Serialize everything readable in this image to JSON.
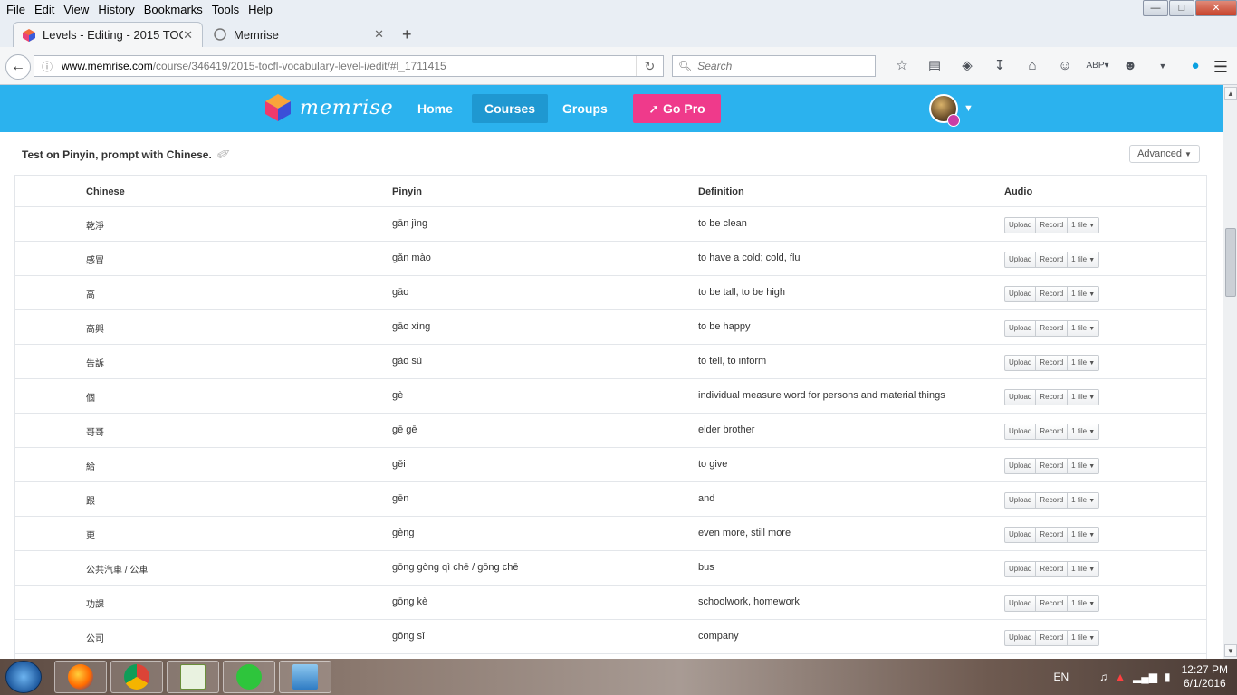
{
  "menu": [
    "File",
    "Edit",
    "View",
    "History",
    "Bookmarks",
    "Tools",
    "Help"
  ],
  "tabs": [
    {
      "title": "Levels - Editing - 2015 TOC...",
      "close": "✕"
    },
    {
      "title": "Memrise",
      "close": "✕"
    }
  ],
  "newtab": "+",
  "url": {
    "host": "www.memrise.com",
    "path": "/course/346419/2015-tocfl-vocabulary-level-i/edit/#l_1711415"
  },
  "search": {
    "placeholder": "Search"
  },
  "memrise": {
    "logo_text": "memrise",
    "nav": [
      "Home",
      "Courses",
      "Groups"
    ],
    "gopro": "Go Pro",
    "colors": {
      "header": "#2bb2ee",
      "active_nav": "#1f98d1",
      "gopro": "#ef3a8b"
    }
  },
  "level": {
    "test_label": "Test on Pinyin, prompt with Chinese.",
    "advanced": "Advanced"
  },
  "table": {
    "headers": [
      "Chinese",
      "Pinyin",
      "Definition",
      "Audio"
    ],
    "audio_buttons": {
      "upload": "Upload",
      "record": "Record",
      "files": "1 file"
    },
    "rows": [
      {
        "chinese": "乾淨",
        "pinyin": "gān jìng",
        "definition": "to be clean"
      },
      {
        "chinese": "感冒",
        "pinyin": "gǎn mào",
        "definition": "to have a cold; cold, flu"
      },
      {
        "chinese": "高",
        "pinyin": "gāo",
        "definition": "to be tall, to be high"
      },
      {
        "chinese": "高興",
        "pinyin": "gāo xìng",
        "definition": "to be happy"
      },
      {
        "chinese": "告訴",
        "pinyin": "gào sù",
        "definition": "to tell, to inform"
      },
      {
        "chinese": "個",
        "pinyin": "gè",
        "definition": "individual measure word for persons and material things"
      },
      {
        "chinese": "哥哥",
        "pinyin": "gē gē",
        "definition": "elder brother"
      },
      {
        "chinese": "給",
        "pinyin": "gěi",
        "definition": "to give"
      },
      {
        "chinese": "跟",
        "pinyin": "gēn",
        "definition": "and"
      },
      {
        "chinese": "更",
        "pinyin": "gèng",
        "definition": "even more, still more"
      },
      {
        "chinese": "公共汽車 / 公車",
        "pinyin": "gōng gòng qì chē / gōng chē",
        "definition": "bus"
      },
      {
        "chinese": "功課",
        "pinyin": "gōng kè",
        "definition": "schoolwork, homework"
      },
      {
        "chinese": "公司",
        "pinyin": "gōng sī",
        "definition": "company"
      }
    ]
  },
  "taskbar": {
    "lang": "EN",
    "time": "12:27 PM",
    "date": "6/1/2016"
  }
}
